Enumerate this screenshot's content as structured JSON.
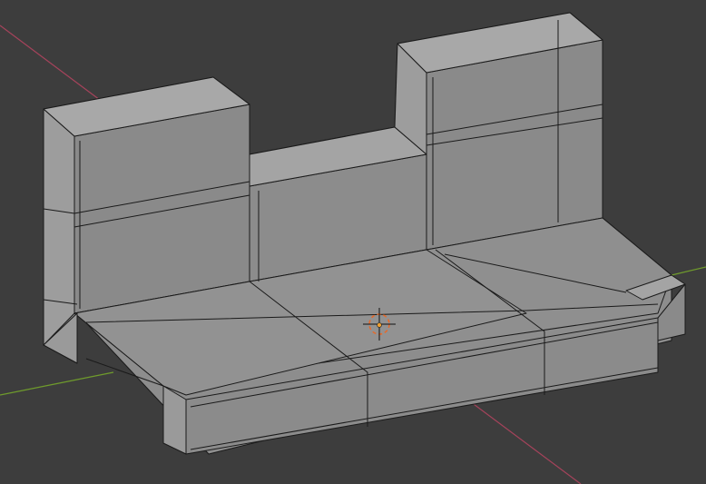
{
  "viewport": {
    "background_color": "#3d3d3d",
    "axis_x_color": "#a5435b",
    "axis_y_color": "#6f9b2c",
    "mesh_light_face": "#9e9e9e",
    "mesh_mid_face": "#8b8b8b",
    "mesh_dark_face": "#7a7a7a",
    "mesh_top_face": "#a7a7a7",
    "edge_color": "#1a1a1a",
    "cursor_color": "#e46a2c",
    "objects": [
      "3d-cursor",
      "origin-point",
      "mesh-object"
    ]
  }
}
